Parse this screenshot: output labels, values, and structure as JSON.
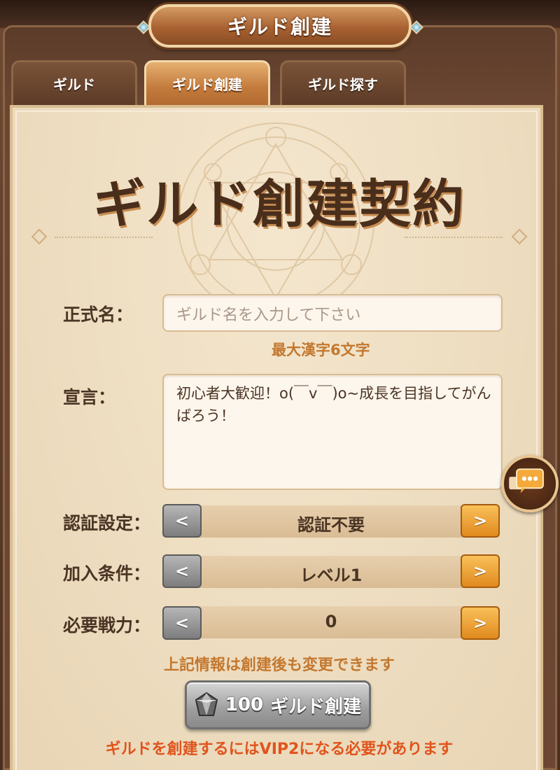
{
  "window": {
    "title": "ギルド創建"
  },
  "tabs": [
    {
      "label": "ギルド",
      "active": false
    },
    {
      "label": "ギルド創建",
      "active": true
    },
    {
      "label": "ギルド探す",
      "active": false
    }
  ],
  "contract": {
    "title": "ギルド創建契約"
  },
  "form": {
    "name": {
      "label": "正式名：",
      "placeholder": "ギルド名を入力して下さい",
      "value": "",
      "hint": "最大漢字6文字"
    },
    "declaration": {
      "label": "宣言：",
      "value": "初心者大歓迎！o(￣v￣)o~成長を目指してがんばろう！"
    },
    "selectors": [
      {
        "label": "認証設定：",
        "value": "認証不要"
      },
      {
        "label": "加入条件：",
        "value": "レベル1"
      },
      {
        "label": "必要戦力：",
        "value": "0"
      }
    ],
    "arrows": {
      "prev": "<",
      "next": ">"
    },
    "note": "上記情報は創建後も変更できます"
  },
  "create_button": {
    "cost": "100",
    "label": "ギルド創建",
    "icon": "diamond-gem-icon"
  },
  "warning": "ギルドを創建するにはVIP2になる必要があります",
  "chat": {
    "icon": "chat-bubble-icon"
  },
  "colors": {
    "accent_orange": "#c3782f",
    "warning_red": "#e0541c",
    "text_dark": "#4a3424",
    "parchment": "#f2e3c8"
  }
}
